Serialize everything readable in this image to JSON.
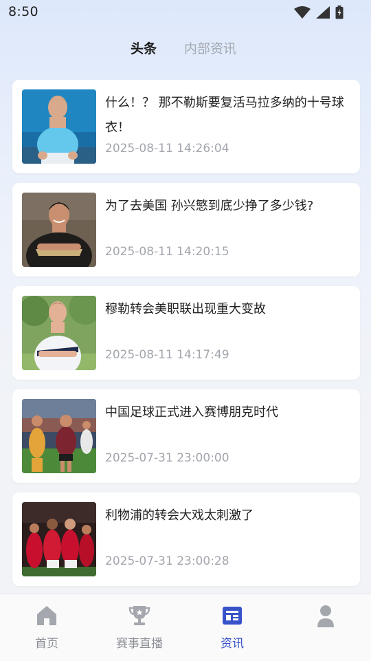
{
  "status_bar": {
    "time": "8:50",
    "icons": [
      "wifi-icon",
      "signal-icon",
      "battery-icon"
    ]
  },
  "tabs": [
    {
      "label": "头条",
      "active": true
    },
    {
      "label": "内部资讯",
      "active": false
    }
  ],
  "articles": [
    {
      "title": "什么！？ 那不勒斯要复活马拉多纳的十号球衣！",
      "time": "2025-08-11 14:26:04"
    },
    {
      "title": "为了去美国 孙兴慜到底少挣了多少钱?",
      "time": "2025-08-11 14:20:15"
    },
    {
      "title": "穆勒转会美职联出现重大变故",
      "time": "2025-08-11 14:17:49"
    },
    {
      "title": "中国足球正式进入赛博朋克时代",
      "time": "2025-07-31 23:00:00"
    },
    {
      "title": "利物浦的转会大戏太刺激了",
      "time": "2025-07-31 23:00:28"
    }
  ],
  "bottom_nav": [
    {
      "label": "首页",
      "icon": "home-icon",
      "active": false
    },
    {
      "label": "赛事直播",
      "icon": "trophy-icon",
      "active": false
    },
    {
      "label": "资讯",
      "icon": "news-icon",
      "active": true
    },
    {
      "label": "",
      "icon": "profile-icon",
      "active": false
    }
  ],
  "colors": {
    "accent": "#3852c9",
    "inactive": "#8d9096",
    "time_text": "#a3a6ad"
  }
}
